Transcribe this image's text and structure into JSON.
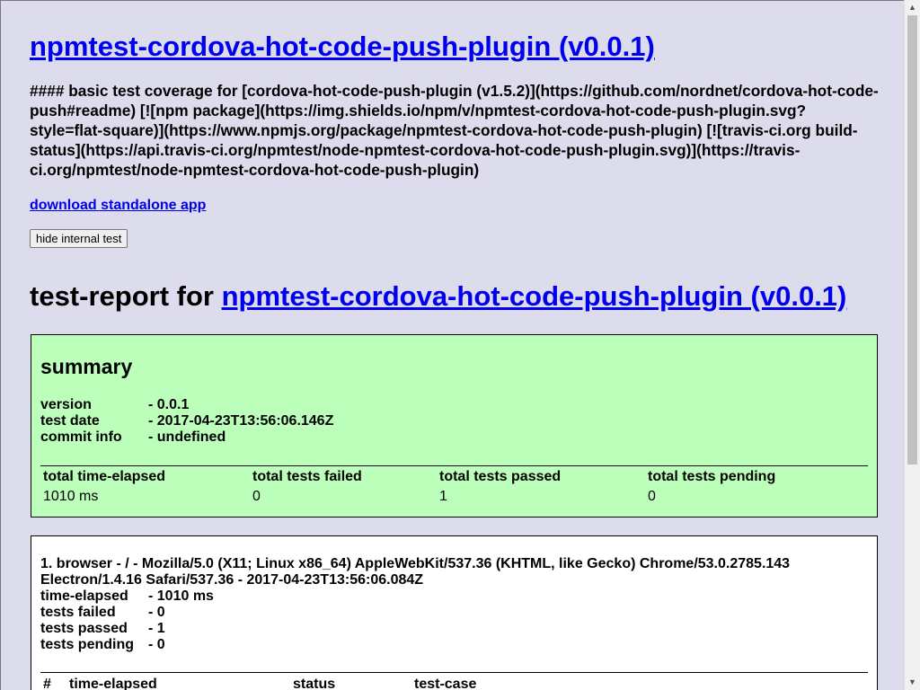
{
  "header": {
    "title_link": "npmtest-cordova-hot-code-push-plugin (v0.0.1)",
    "description": "#### basic test coverage for [cordova-hot-code-push-plugin (v1.5.2)](https://github.com/nordnet/cordova-hot-code-push#readme) [![npm package](https://img.shields.io/npm/v/npmtest-cordova-hot-code-push-plugin.svg?style=flat-square)](https://www.npmjs.org/package/npmtest-cordova-hot-code-push-plugin) [![travis-ci.org build-status](https://api.travis-ci.org/npmtest/node-npmtest-cordova-hot-code-push-plugin.svg)](https://travis-ci.org/npmtest/node-npmtest-cordova-hot-code-push-plugin)",
    "download_link": "download standalone app",
    "hide_button": "hide internal test"
  },
  "report": {
    "title_prefix": "test-report for ",
    "title_link": "npmtest-cordova-hot-code-push-plugin (v0.0.1)"
  },
  "summary": {
    "heading": "summary",
    "rows": [
      {
        "key": "version",
        "value": "- 0.0.1"
      },
      {
        "key": "test date",
        "value": "- 2017-04-23T13:56:06.146Z"
      },
      {
        "key": "commit info",
        "value": "- undefined"
      }
    ],
    "table": {
      "headers": [
        "total time-elapsed",
        "total tests failed",
        "total tests passed",
        "total tests pending"
      ],
      "values": [
        "1010 ms",
        "0",
        "1",
        "0"
      ]
    }
  },
  "browser": {
    "heading": "1. browser - / - Mozilla/5.0 (X11; Linux x86_64) AppleWebKit/537.36 (KHTML, like Gecko) Chrome/53.0.2785.143 Electron/1.4.16 Safari/537.36 - 2017-04-23T13:56:06.084Z",
    "rows": [
      {
        "key": "time-elapsed",
        "value": "- 1010 ms"
      },
      {
        "key": "tests failed",
        "value": "- 0"
      },
      {
        "key": "tests passed",
        "value": "- 1"
      },
      {
        "key": "tests pending",
        "value": "- 0"
      }
    ],
    "table_headers": [
      "#",
      "time-elapsed",
      "status",
      "test-case"
    ]
  },
  "colors": {
    "page_bg": "#dcdcec",
    "link": "#0000ee",
    "summary_bg": "#bbffbb",
    "browser_bg": "#ffffff"
  },
  "icons": {
    "scroll_up": "scroll-up-arrow-icon",
    "scroll_down": "scroll-down-arrow-icon"
  }
}
